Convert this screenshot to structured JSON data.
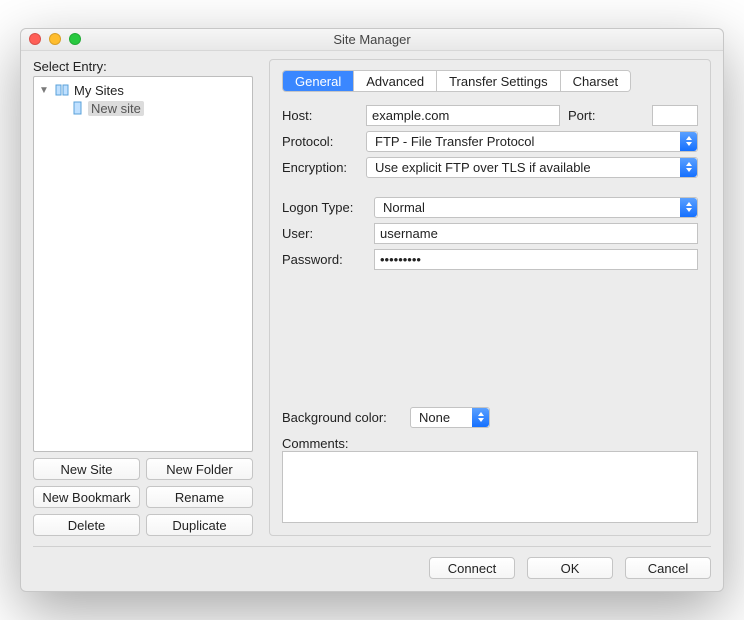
{
  "window": {
    "title": "Site Manager"
  },
  "left": {
    "select_label": "Select Entry:",
    "tree": {
      "root": "My Sites",
      "items": [
        "New site"
      ]
    },
    "buttons": {
      "new_site": "New Site",
      "new_folder": "New Folder",
      "new_bookmark": "New Bookmark",
      "rename": "Rename",
      "delete": "Delete",
      "duplicate": "Duplicate"
    }
  },
  "tabs": {
    "general": "General",
    "advanced": "Advanced",
    "transfer": "Transfer Settings",
    "charset": "Charset"
  },
  "form": {
    "host_label": "Host:",
    "host_value": "example.com",
    "port_label": "Port:",
    "port_value": "",
    "protocol_label": "Protocol:",
    "protocol_value": "FTP - File Transfer Protocol",
    "encryption_label": "Encryption:",
    "encryption_value": "Use explicit FTP over TLS if available",
    "logon_label": "Logon Type:",
    "logon_value": "Normal",
    "user_label": "User:",
    "user_value": "username",
    "password_label": "Password:",
    "password_value": "•••••••••",
    "bg_label": "Background color:",
    "bg_value": "None",
    "comments_label": "Comments:",
    "comments_value": ""
  },
  "footer": {
    "connect": "Connect",
    "ok": "OK",
    "cancel": "Cancel"
  }
}
